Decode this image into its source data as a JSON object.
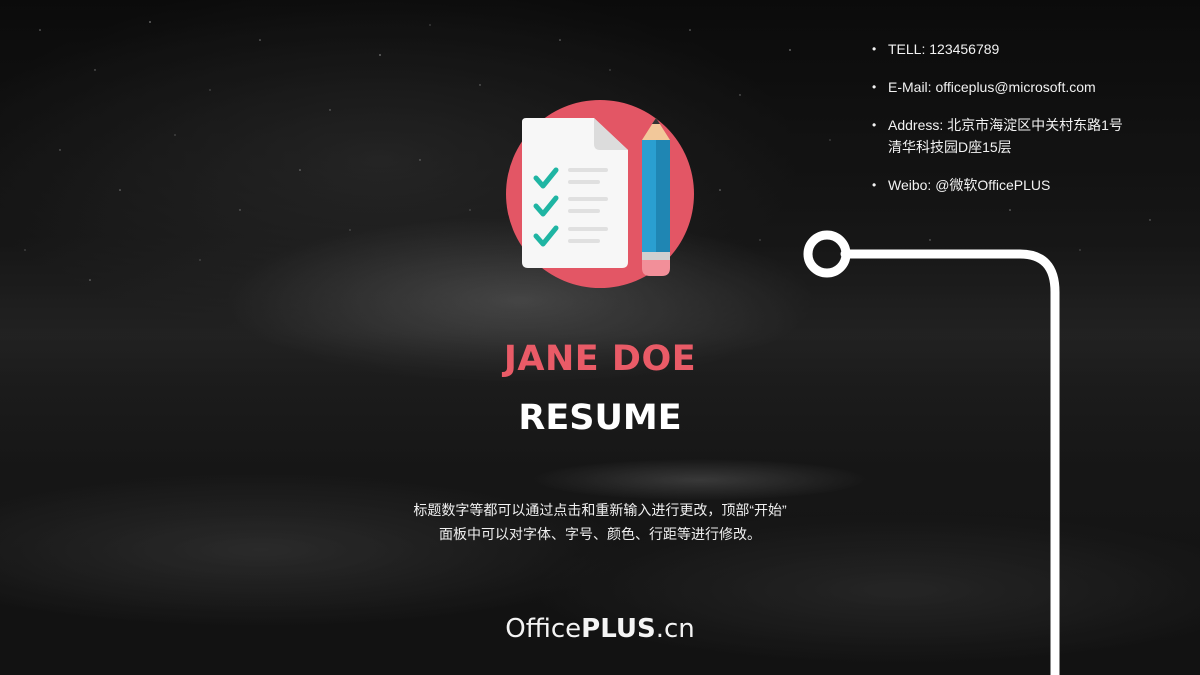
{
  "contacts": [
    {
      "text": "TELL: 123456789"
    },
    {
      "text": "E-Mail: officeplus@microsoft.com"
    },
    {
      "line1": "Address: 北京市海淀区中关村东路1号",
      "line2": "清华科技园D座15层"
    },
    {
      "text": "Weibo: @微软OfficePLUS"
    }
  ],
  "name": "JANE DOE",
  "title": "RESUME",
  "description": {
    "line1": "标题数字等都可以通过点击和重新输入进行更改，顶部“开始”",
    "line2": "面板中可以对字体、字号、颜色、行距等进行修改。"
  },
  "brand": {
    "prefix": "Office",
    "bold": "PLUS",
    "suffix": ".cn"
  },
  "colors": {
    "accent": "#e95b67",
    "icon_circle": "#e35665",
    "check": "#1fb5a3",
    "pencil": "#2a9fd0"
  },
  "icons": [
    "resume-checklist-icon",
    "pencil-icon"
  ]
}
